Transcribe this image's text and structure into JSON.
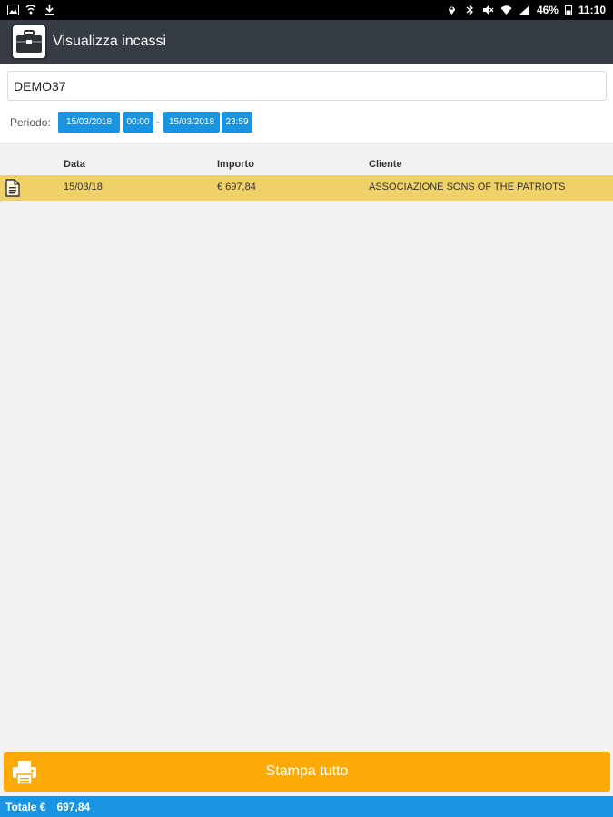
{
  "status_bar": {
    "battery": "46%",
    "time": "11:10",
    "left_icons": [
      "image-icon",
      "cast-icon",
      "download-icon"
    ],
    "right_icons": [
      "location-icon",
      "bluetooth-icon",
      "mute-icon",
      "wifi-icon",
      "signal-icon",
      "battery-icon"
    ]
  },
  "app_bar": {
    "title": "Visualizza incassi",
    "icon": "briefcase-icon"
  },
  "filter": {
    "search_value": "DEMO37",
    "period_label": "Periodo:",
    "from_date": "15/03/2018",
    "from_time": "00:00",
    "separator": "-",
    "to_date": "15/03/2018",
    "to_time": "23:59"
  },
  "table": {
    "headers": [
      "Data",
      "Importo",
      "Cliente"
    ],
    "rows": [
      {
        "icon": "document-icon",
        "data": "15/03/18",
        "importo": "€ 697,84",
        "cliente": "ASSOCIAZIONE SONS OF THE PATRIOTS"
      }
    ]
  },
  "actions": {
    "print_all": "Stampa tutto"
  },
  "totals": {
    "label": "Totale €",
    "value": "697,84"
  },
  "colors": {
    "app_bar": "#353c44",
    "accent_blue": "#1a94e0",
    "print_orange": "#fbaa08",
    "row_highlight": "#f0d068"
  }
}
